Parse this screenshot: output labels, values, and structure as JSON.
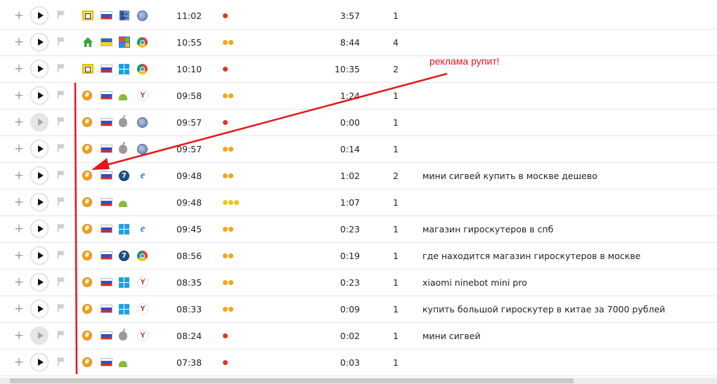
{
  "annotation": {
    "text": "реклама рупит!",
    "color": "#e8141b"
  },
  "colors": {
    "red_dot": "#e8321e",
    "orange_dot": "#f5a60f",
    "yellow_dot": "#f2c80f"
  },
  "rows": [
    {
      "source": "link",
      "country": "ru",
      "os": "mac-old",
      "browser": "opera",
      "time": "11:02",
      "dots": [
        "red"
      ],
      "duration": "3:57",
      "count": "1",
      "query": "",
      "play_disabled": false
    },
    {
      "source": "home",
      "country": "ua",
      "os": "winxp",
      "browser": "chrome",
      "time": "10:55",
      "dots": [
        "orange",
        "orange"
      ],
      "duration": "8:44",
      "count": "4",
      "query": "",
      "play_disabled": false
    },
    {
      "source": "link",
      "country": "ru",
      "os": "windows",
      "browser": "chrome",
      "time": "10:10",
      "dots": [
        "red"
      ],
      "duration": "10:35",
      "count": "2",
      "query": "",
      "play_disabled": false
    },
    {
      "source": "paid",
      "country": "ru",
      "os": "android",
      "browser": "yandex",
      "time": "09:58",
      "dots": [
        "orange",
        "orange"
      ],
      "duration": "1:24",
      "count": "1",
      "query": "",
      "play_disabled": false
    },
    {
      "source": "paid",
      "country": "ru",
      "os": "apple",
      "browser": "opera",
      "time": "09:57",
      "dots": [
        "red"
      ],
      "duration": "0:00",
      "count": "1",
      "query": "",
      "play_disabled": true
    },
    {
      "source": "paid",
      "country": "ru",
      "os": "apple",
      "browser": "opera",
      "time": "09:57",
      "dots": [
        "orange",
        "orange"
      ],
      "duration": "0:14",
      "count": "1",
      "query": "",
      "play_disabled": false
    },
    {
      "source": "paid",
      "country": "ru",
      "os": "win7",
      "browser": "ie",
      "time": "09:48",
      "dots": [
        "orange",
        "orange"
      ],
      "duration": "1:02",
      "count": "2",
      "query": "мини сигвей купить в москве дешево",
      "play_disabled": false
    },
    {
      "source": "paid",
      "country": "ru",
      "os": "android",
      "browser": "",
      "time": "09:48",
      "dots": [
        "yellow",
        "yellow",
        "yellow"
      ],
      "duration": "1:07",
      "count": "1",
      "query": "",
      "play_disabled": false
    },
    {
      "source": "paid",
      "country": "ru",
      "os": "windows",
      "browser": "ie",
      "time": "09:45",
      "dots": [
        "orange",
        "orange"
      ],
      "duration": "0:23",
      "count": "1",
      "query": "магазин гироскутеров в спб",
      "play_disabled": false
    },
    {
      "source": "paid",
      "country": "ru",
      "os": "win7",
      "browser": "chrome",
      "time": "08:56",
      "dots": [
        "orange",
        "orange"
      ],
      "duration": "0:19",
      "count": "1",
      "query": "где находится магазин гироскутеров в москве",
      "play_disabled": false
    },
    {
      "source": "paid",
      "country": "ru",
      "os": "windows",
      "browser": "yandex",
      "time": "08:35",
      "dots": [
        "orange",
        "orange"
      ],
      "duration": "0:23",
      "count": "1",
      "query": "xiaomi ninebot mini pro",
      "play_disabled": false
    },
    {
      "source": "paid",
      "country": "ru",
      "os": "windows",
      "browser": "yandex",
      "time": "08:33",
      "dots": [
        "orange",
        "orange"
      ],
      "duration": "0:09",
      "count": "1",
      "query": "купить большой гироскутер в китае за 7000 рублей",
      "play_disabled": false
    },
    {
      "source": "paid",
      "country": "ru",
      "os": "apple",
      "browser": "yandex",
      "time": "08:24",
      "dots": [
        "red"
      ],
      "duration": "0:02",
      "count": "1",
      "query": "мини сигвей",
      "play_disabled": true
    },
    {
      "source": "paid",
      "country": "ru",
      "os": "android",
      "browser": "",
      "time": "07:38",
      "dots": [
        "red"
      ],
      "duration": "0:03",
      "count": "1",
      "query": "",
      "play_disabled": false
    }
  ]
}
